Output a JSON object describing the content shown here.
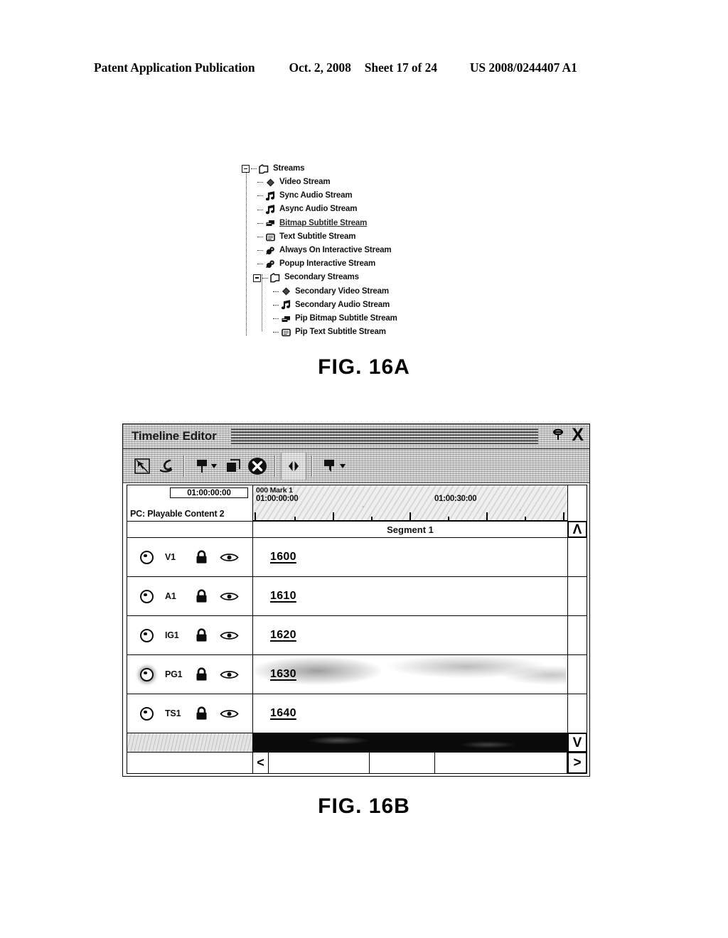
{
  "header": {
    "publication": "Patent Application Publication",
    "date": "Oct. 2, 2008",
    "sheet": "Sheet 17 of 24",
    "patent_number": "US 2008/0244407 A1"
  },
  "fig16a": {
    "caption": "FIG. 16A",
    "tree": [
      {
        "label": "Streams",
        "level": 0,
        "icon": "folder-icon",
        "expander": "minus",
        "selected": false
      },
      {
        "label": "Video Stream",
        "level": 1,
        "icon": "video-stream-icon",
        "expander": "none",
        "selected": false
      },
      {
        "label": "Sync Audio Stream",
        "level": 1,
        "icon": "audio-note-icon",
        "expander": "none",
        "selected": false
      },
      {
        "label": "Async Audio Stream",
        "level": 1,
        "icon": "audio-note-icon",
        "expander": "none",
        "selected": false
      },
      {
        "label": "Bitmap Subtitle Stream",
        "level": 1,
        "icon": "bitmap-subtitle-icon",
        "expander": "none",
        "selected": true
      },
      {
        "label": "Text Subtitle Stream",
        "level": 1,
        "icon": "text-subtitle-icon",
        "expander": "none",
        "selected": false
      },
      {
        "label": "Always On Interactive Stream",
        "level": 1,
        "icon": "interactive-stream-icon",
        "expander": "none",
        "selected": false
      },
      {
        "label": "Popup Interactive Stream",
        "level": 1,
        "icon": "interactive-stream-icon",
        "expander": "none",
        "selected": false
      },
      {
        "label": "Secondary Streams",
        "level": 1,
        "icon": "folder-icon",
        "expander": "minus",
        "selected": false
      },
      {
        "label": "Secondary Video Stream",
        "level": 2,
        "icon": "video-stream-icon",
        "expander": "none",
        "selected": false
      },
      {
        "label": "Secondary Audio Stream",
        "level": 2,
        "icon": "audio-note-icon",
        "expander": "none",
        "selected": false
      },
      {
        "label": "Pip Bitmap Subtitle Stream",
        "level": 2,
        "icon": "bitmap-subtitle-icon",
        "expander": "none",
        "selected": false
      },
      {
        "label": "Pip Text Subtitle Stream",
        "level": 2,
        "icon": "text-subtitle-icon",
        "expander": "none",
        "selected": false
      }
    ]
  },
  "fig16b": {
    "caption": "FIG. 16B",
    "window": {
      "title": "Timeline Editor",
      "pin_icon": "pushpin-icon",
      "close_label": "X"
    },
    "toolbar": {
      "buttons": [
        {
          "name": "selection-arrow-tool",
          "icon": "arrow-in-box-icon",
          "has_dropdown": false
        },
        {
          "name": "lasso-trim-tool",
          "icon": "curve-hook-icon",
          "has_dropdown": false
        },
        {
          "name": "marker-tool",
          "icon": "flag-marker-icon",
          "has_dropdown": true
        },
        {
          "name": "duplicate-tool",
          "icon": "stacked-squares-icon",
          "has_dropdown": false
        },
        {
          "name": "delete-tool",
          "icon": "x-circle-icon",
          "has_dropdown": false
        },
        {
          "name": "expand-range-tool",
          "icon": "left-right-icon",
          "has_dropdown": false
        },
        {
          "name": "secondary-marker-tool",
          "icon": "flag-marker-icon",
          "has_dropdown": true
        }
      ]
    },
    "timeline": {
      "current_timecode": "01:00:00:00",
      "playable_content_label": "PC: Playable Content 2",
      "mark_label": "000 Mark 1",
      "mark_timecode": "01:00:00:00",
      "mid_timecode": "01:00:30:00",
      "segment_label": "Segment 1"
    },
    "tracks": [
      {
        "name": "V1",
        "reference": "1600",
        "locked": true,
        "visible": true,
        "selected": true,
        "smudged": false
      },
      {
        "name": "A1",
        "reference": "1610",
        "locked": true,
        "visible": true,
        "selected": true,
        "smudged": false
      },
      {
        "name": "IG1",
        "reference": "1620",
        "locked": true,
        "visible": true,
        "selected": true,
        "smudged": false
      },
      {
        "name": "PG1",
        "reference": "1630",
        "locked": true,
        "visible": true,
        "selected": true,
        "smudged": true
      },
      {
        "name": "TS1",
        "reference": "1640",
        "locked": true,
        "visible": true,
        "selected": true,
        "smudged": false
      }
    ],
    "scrollbars": {
      "up_arrow": "Λ",
      "down_arrow": "V",
      "left_arrow": "<",
      "right_arrow": ">"
    }
  }
}
